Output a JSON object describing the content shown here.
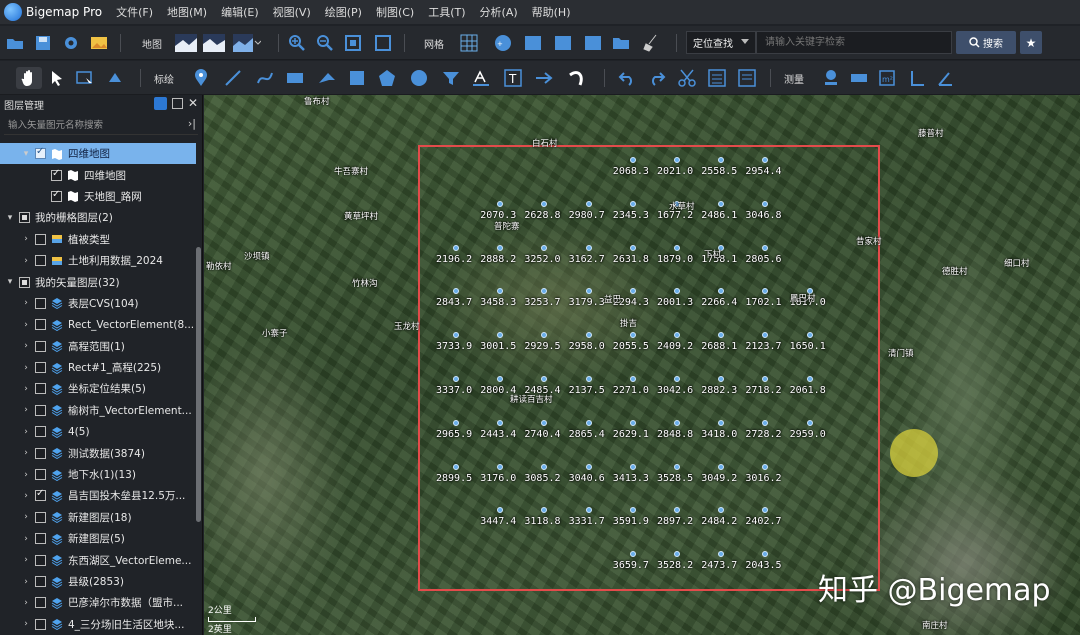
{
  "app": {
    "name": "Bigemap Pro"
  },
  "menu": [
    "文件(F)",
    "地图(M)",
    "编辑(E)",
    "视图(V)",
    "绘图(P)",
    "制图(C)",
    "工具(T)",
    "分析(A)",
    "帮助(H)"
  ],
  "toolbar1": {
    "map_label": "地图",
    "grid_label": "网格",
    "locate_select": "定位查找",
    "search_placeholder": "请输入关键字检索",
    "search_button": "搜索"
  },
  "toolbar2": {
    "annotate_label": "标绘",
    "measure_label": "测量"
  },
  "panel": {
    "title": "图层管理",
    "search_placeholder": "输入矢量图元名称搜索",
    "rows": [
      {
        "label": "四维地图",
        "indent": 1,
        "arrow": "▾",
        "check": "on",
        "icon": "map",
        "selected": true
      },
      {
        "label": "四维地图",
        "indent": 2,
        "arrow": "",
        "check": "on",
        "icon": "map"
      },
      {
        "label": "天地图_路网",
        "indent": 2,
        "arrow": "",
        "check": "on",
        "icon": "map"
      },
      {
        "label": "我的栅格图层(2)",
        "indent": 0,
        "arrow": "▾",
        "check": "sq",
        "icon": ""
      },
      {
        "label": "植被类型",
        "indent": 1,
        "arrow": "›",
        "check": "off",
        "icon": "raster"
      },
      {
        "label": "土地利用数据_2024",
        "indent": 1,
        "arrow": "›",
        "check": "off",
        "icon": "raster"
      },
      {
        "label": "我的矢量图层(32)",
        "indent": 0,
        "arrow": "▾",
        "check": "sq",
        "icon": ""
      },
      {
        "label": "表层CVS(104)",
        "indent": 1,
        "arrow": "›",
        "check": "off",
        "icon": "layers"
      },
      {
        "label": "Rect_VectorElement(8...",
        "indent": 1,
        "arrow": "›",
        "check": "off",
        "icon": "layers"
      },
      {
        "label": "高程范围(1)",
        "indent": 1,
        "arrow": "›",
        "check": "off",
        "icon": "layers"
      },
      {
        "label": "Rect#1_高程(225)",
        "indent": 1,
        "arrow": "›",
        "check": "off",
        "icon": "layers"
      },
      {
        "label": "坐标定位结果(5)",
        "indent": 1,
        "arrow": "›",
        "check": "off",
        "icon": "layers"
      },
      {
        "label": "榆树市_VectorElement...",
        "indent": 1,
        "arrow": "›",
        "check": "off",
        "icon": "layers"
      },
      {
        "label": "4(5)",
        "indent": 1,
        "arrow": "›",
        "check": "off",
        "icon": "layers"
      },
      {
        "label": "测试数据(3874)",
        "indent": 1,
        "arrow": "›",
        "check": "off",
        "icon": "layers"
      },
      {
        "label": "地下水(1)(13)",
        "indent": 1,
        "arrow": "›",
        "check": "off",
        "icon": "layers"
      },
      {
        "label": "昌吉国投木垒县12.5万...",
        "indent": 1,
        "arrow": "›",
        "check": "on",
        "icon": "layers"
      },
      {
        "label": "新建图层(18)",
        "indent": 1,
        "arrow": "›",
        "check": "off",
        "icon": "layers"
      },
      {
        "label": "新建图层(5)",
        "indent": 1,
        "arrow": "›",
        "check": "off",
        "icon": "layers"
      },
      {
        "label": "东西湖区_VectorEleme...",
        "indent": 1,
        "arrow": "›",
        "check": "off",
        "icon": "layers"
      },
      {
        "label": "县级(2853)",
        "indent": 1,
        "arrow": "›",
        "check": "off",
        "icon": "layers"
      },
      {
        "label": "巴彦淖尔市数据（盟市...",
        "indent": 1,
        "arrow": "›",
        "check": "off",
        "icon": "layers"
      },
      {
        "label": "4_三分场旧生活区地块...",
        "indent": 1,
        "arrow": "›",
        "check": "off",
        "icon": "layers"
      }
    ]
  },
  "map": {
    "elevations": [
      {
        "v": "2068.3",
        "c": 4,
        "r": 0
      },
      {
        "v": "2021.0",
        "c": 5,
        "r": 0
      },
      {
        "v": "2558.5",
        "c": 6,
        "r": 0
      },
      {
        "v": "2954.4",
        "c": 7,
        "r": 0
      },
      {
        "v": "2070.3",
        "c": 1,
        "r": 1
      },
      {
        "v": "2628.8",
        "c": 2,
        "r": 1
      },
      {
        "v": "2980.7",
        "c": 3,
        "r": 1
      },
      {
        "v": "2345.3",
        "c": 4,
        "r": 1
      },
      {
        "v": "1677.2",
        "c": 5,
        "r": 1
      },
      {
        "v": "2486.1",
        "c": 6,
        "r": 1
      },
      {
        "v": "3046.8",
        "c": 7,
        "r": 1
      },
      {
        "v": "2196.2",
        "c": 0,
        "r": 2
      },
      {
        "v": "2888.2",
        "c": 1,
        "r": 2
      },
      {
        "v": "3252.0",
        "c": 2,
        "r": 2
      },
      {
        "v": "3162.7",
        "c": 3,
        "r": 2
      },
      {
        "v": "2631.8",
        "c": 4,
        "r": 2
      },
      {
        "v": "1879.0",
        "c": 5,
        "r": 2
      },
      {
        "v": "1758.1",
        "c": 6,
        "r": 2
      },
      {
        "v": "2805.6",
        "c": 7,
        "r": 2
      },
      {
        "v": "2843.7",
        "c": 0,
        "r": 3
      },
      {
        "v": "3458.3",
        "c": 1,
        "r": 3
      },
      {
        "v": "3253.7",
        "c": 2,
        "r": 3
      },
      {
        "v": "3179.3",
        "c": 3,
        "r": 3
      },
      {
        "v": "2294.3",
        "c": 4,
        "r": 3
      },
      {
        "v": "2001.3",
        "c": 5,
        "r": 3
      },
      {
        "v": "2266.4",
        "c": 6,
        "r": 3
      },
      {
        "v": "1702.1",
        "c": 7,
        "r": 3
      },
      {
        "v": "1817.0",
        "c": 8,
        "r": 3
      },
      {
        "v": "3733.9",
        "c": 0,
        "r": 4
      },
      {
        "v": "3001.5",
        "c": 1,
        "r": 4
      },
      {
        "v": "2929.5",
        "c": 2,
        "r": 4
      },
      {
        "v": "2958.0",
        "c": 3,
        "r": 4
      },
      {
        "v": "2055.5",
        "c": 4,
        "r": 4
      },
      {
        "v": "2409.2",
        "c": 5,
        "r": 4
      },
      {
        "v": "2688.1",
        "c": 6,
        "r": 4
      },
      {
        "v": "2123.7",
        "c": 7,
        "r": 4
      },
      {
        "v": "1650.1",
        "c": 8,
        "r": 4
      },
      {
        "v": "3337.0",
        "c": 0,
        "r": 5
      },
      {
        "v": "2800.4",
        "c": 1,
        "r": 5
      },
      {
        "v": "2485.4",
        "c": 2,
        "r": 5
      },
      {
        "v": "2137.5",
        "c": 3,
        "r": 5
      },
      {
        "v": "2271.0",
        "c": 4,
        "r": 5
      },
      {
        "v": "3042.6",
        "c": 5,
        "r": 5
      },
      {
        "v": "2882.3",
        "c": 6,
        "r": 5
      },
      {
        "v": "2718.2",
        "c": 7,
        "r": 5
      },
      {
        "v": "2061.8",
        "c": 8,
        "r": 5
      },
      {
        "v": "2965.9",
        "c": 0,
        "r": 6
      },
      {
        "v": "2443.4",
        "c": 1,
        "r": 6
      },
      {
        "v": "2740.4",
        "c": 2,
        "r": 6
      },
      {
        "v": "2865.4",
        "c": 3,
        "r": 6
      },
      {
        "v": "2629.1",
        "c": 4,
        "r": 6
      },
      {
        "v": "2848.8",
        "c": 5,
        "r": 6
      },
      {
        "v": "3418.0",
        "c": 6,
        "r": 6
      },
      {
        "v": "2728.2",
        "c": 7,
        "r": 6
      },
      {
        "v": "2959.0",
        "c": 8,
        "r": 6
      },
      {
        "v": "2899.5",
        "c": 0,
        "r": 7
      },
      {
        "v": "3176.0",
        "c": 1,
        "r": 7
      },
      {
        "v": "3085.2",
        "c": 2,
        "r": 7
      },
      {
        "v": "3040.6",
        "c": 3,
        "r": 7
      },
      {
        "v": "3413.3",
        "c": 4,
        "r": 7
      },
      {
        "v": "3528.5",
        "c": 5,
        "r": 7
      },
      {
        "v": "3049.2",
        "c": 6,
        "r": 7
      },
      {
        "v": "3016.2",
        "c": 7,
        "r": 7
      },
      {
        "v": "3447.4",
        "c": 1,
        "r": 8
      },
      {
        "v": "3118.8",
        "c": 2,
        "r": 8
      },
      {
        "v": "3331.7",
        "c": 3,
        "r": 8
      },
      {
        "v": "3591.9",
        "c": 4,
        "r": 8
      },
      {
        "v": "2897.2",
        "c": 5,
        "r": 8
      },
      {
        "v": "2484.2",
        "c": 6,
        "r": 8
      },
      {
        "v": "2402.7",
        "c": 7,
        "r": 8
      },
      {
        "v": "3659.7",
        "c": 4,
        "r": 9
      },
      {
        "v": "3528.2",
        "c": 5,
        "r": 9
      },
      {
        "v": "2473.7",
        "c": 6,
        "r": 9
      },
      {
        "v": "2043.5",
        "c": 7,
        "r": 9
      }
    ],
    "places": [
      "鲁布村",
      "白石村",
      "牛吾寨村",
      "黄草坪村",
      "普陀寨",
      "水草村",
      "勒依村",
      "沙坝镇",
      "竹林沟",
      "小寨子",
      "玉龙村",
      "掛吉",
      "清门镇",
      "德胜村",
      "细口村",
      "昔家村",
      "耕读百吉村",
      "下村",
      "鳳巴村",
      "益巴",
      "南庄村",
      "藤普村"
    ],
    "scale": [
      "2公里",
      "2英里"
    ],
    "watermark": "知乎 @Bigemap"
  }
}
